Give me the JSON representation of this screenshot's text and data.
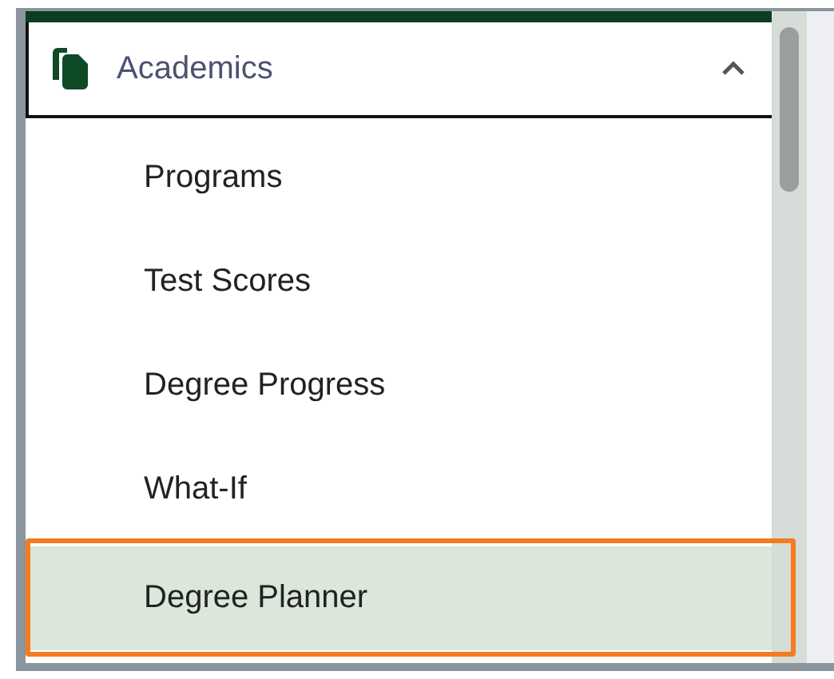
{
  "section": {
    "title": "Academics",
    "expanded": true
  },
  "items": [
    {
      "label": "Programs",
      "selected": false,
      "highlighted": false
    },
    {
      "label": "Test Scores",
      "selected": false,
      "highlighted": false
    },
    {
      "label": "Degree Progress",
      "selected": false,
      "highlighted": false
    },
    {
      "label": "What-If",
      "selected": false,
      "highlighted": false
    },
    {
      "label": "Degree Planner",
      "selected": true,
      "highlighted": true
    }
  ]
}
